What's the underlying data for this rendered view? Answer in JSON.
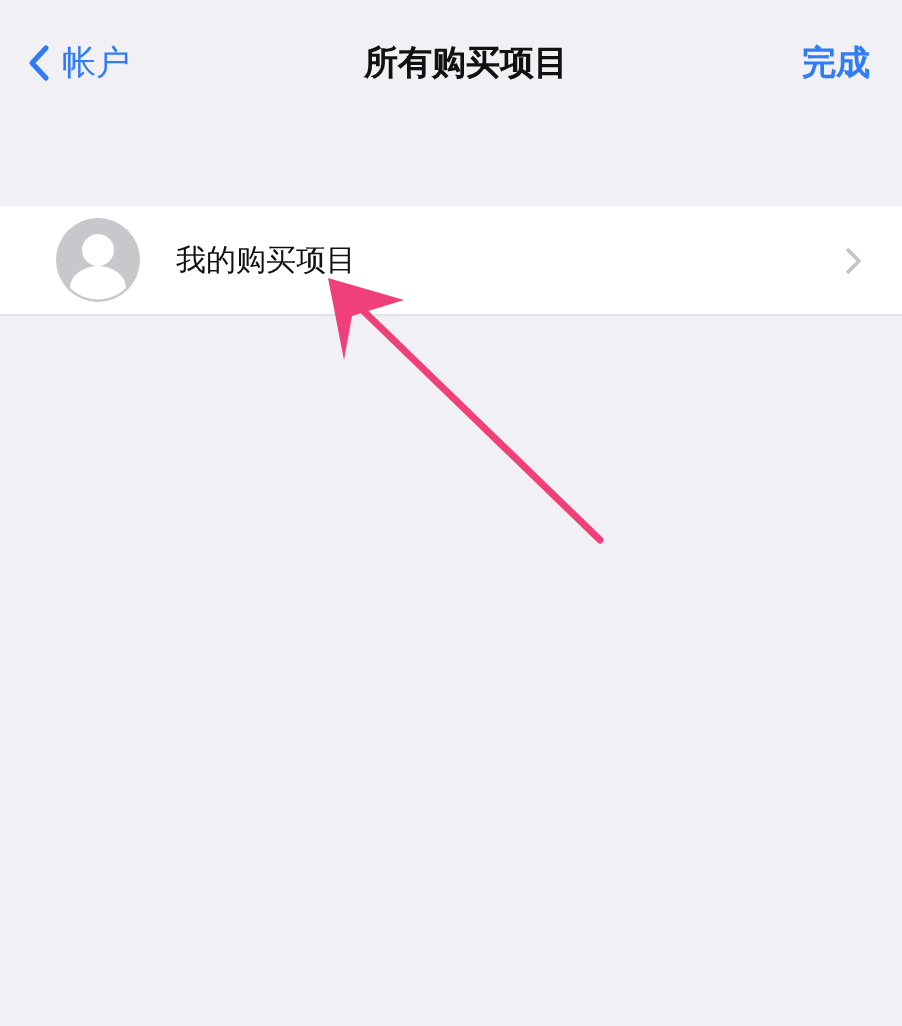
{
  "nav_bar": {
    "back": "帐户",
    "title": "所有购买项目",
    "done": "完成"
  },
  "list": [
    {
      "label": "我的购买项目"
    }
  ]
}
